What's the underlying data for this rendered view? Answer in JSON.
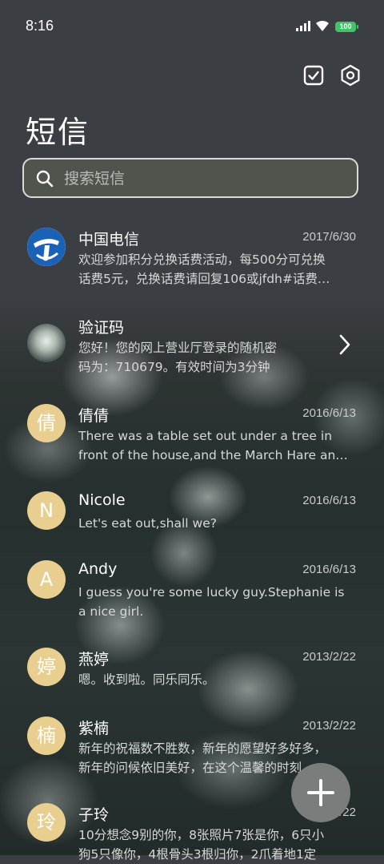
{
  "status_bar": {
    "time": "8:16",
    "battery": "100"
  },
  "header": {
    "title": "短信"
  },
  "search": {
    "placeholder": "搜索短信"
  },
  "conversations": [
    {
      "name": "中国电信",
      "date": "2017/6/30",
      "preview_1": "欢迎参加积分兑换话费活动，每500分可兑换",
      "preview_2": "话费5元，兑换话费请回复106或jfdh#话费…",
      "avatar": "china-telecom-logo"
    },
    {
      "name": "验证码",
      "date": "",
      "preview_1": "您好！您的网上营业厅登录的随机密",
      "preview_2": "码为：710679。有效时间为3分钟",
      "avatar": "photo"
    },
    {
      "name": "倩倩",
      "date": "2016/6/13",
      "preview_1": "There was a table set out under a tree in",
      "preview_2": "front of the house,and the March Hare an…",
      "avatar_text": "倩"
    },
    {
      "name": "Nicole",
      "date": "2016/6/13",
      "preview_1": "Let's eat out,shall we?",
      "preview_2": "",
      "avatar_text": "N"
    },
    {
      "name": "Andy",
      "date": "2016/6/13",
      "preview_1": "I guess you're some lucky guy.Stephanie is",
      "preview_2": "a nice girl.",
      "avatar_text": "A"
    },
    {
      "name": "燕婷",
      "date": "2013/2/22",
      "preview_1": "嗯。收到啦。同乐同乐。",
      "preview_2": "",
      "avatar_text": "婷"
    },
    {
      "name": "紫楠",
      "date": "2013/2/22",
      "preview_1": "新年的祝福数不胜数，新年的愿望好多好多，",
      "preview_2": "新年的问候依旧美好，在这个温馨的时刻…",
      "avatar_text": "楠"
    },
    {
      "name": "子玲",
      "date": "2013/2/22",
      "preview_1": "10分想念9别的你，8张照片7张是你，6只小",
      "preview_2": "狗5只像你，4根骨头3根归你，2爪着地1定",
      "avatar_text": "玲"
    }
  ],
  "colors": {
    "avatar_bg": "#e8cf8f",
    "battery": "#3fc565",
    "fab": "#7a7d7c"
  }
}
